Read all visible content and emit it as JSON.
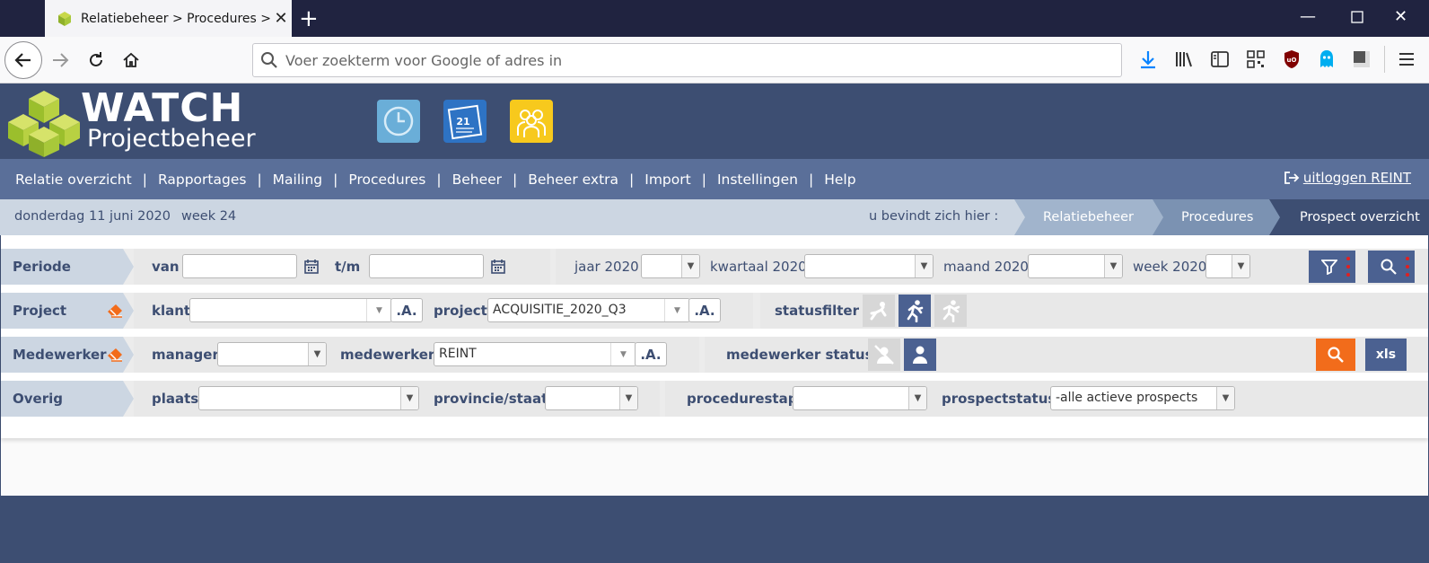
{
  "browser": {
    "tab_title": "Relatiebeheer > Procedures > Prospect overzicht",
    "url_placeholder": "Voer zoekterm voor Google of adres in"
  },
  "app": {
    "logo_title": "WATCH",
    "logo_subtitle": "Projectbeheer",
    "menu": [
      "Relatie overzicht",
      "Rapportages",
      "Mailing",
      "Procedures",
      "Beheer",
      "Beheer extra",
      "Import",
      "Instellingen",
      "Help"
    ],
    "menu_separator": "|",
    "logout_label": "uitloggen REINT",
    "date": "donderdag 11 juni 2020",
    "week": "week 24",
    "you_are_here": "u bevindt zich hier :",
    "breadcrumbs": [
      "Relatiebeheer",
      "Procedures",
      "Prospect overzicht"
    ]
  },
  "filters": {
    "periode": {
      "label": "Periode",
      "van_label": "van",
      "tm_label": "t/m",
      "van_value": "",
      "tm_value": "",
      "jaar_label": "jaar 2020",
      "kwartaal_label": "kwartaal 2020",
      "maand_label": "maand 2020",
      "week_label": "week 2020",
      "jaar_value": "",
      "kwartaal_value": "",
      "maand_value": "",
      "week_value": ""
    },
    "project": {
      "label": "Project",
      "klant_label": "klant",
      "klant_value": "",
      "project_label": "project",
      "project_value": "ACQUISITIE_2020_Q3",
      "a_button": ".A.",
      "statusfilter_label": "statusfilter"
    },
    "medewerker": {
      "label": "Medewerker",
      "manager_label": "manager",
      "manager_value": "",
      "medewerker_label": "medewerker",
      "medewerker_value": "REINT",
      "a_button": ".A.",
      "status_label": "medewerker status",
      "xls_label": "xls"
    },
    "overig": {
      "label": "Overig",
      "plaats_label": "plaats",
      "plaats_value": "",
      "provincie_label": "provincie/staat",
      "provincie_value": "",
      "procedurestap_label": "procedurestap",
      "procedurestap_value": "",
      "prospectstatus_label": "prospectstatus",
      "prospectstatus_value": "-alle actieve prospects"
    }
  },
  "colors": {
    "brand_navy": "#3d4e72",
    "menu_blue": "#5a6f99",
    "accent_orange": "#f26c1b",
    "button_blue": "#4b6191"
  }
}
